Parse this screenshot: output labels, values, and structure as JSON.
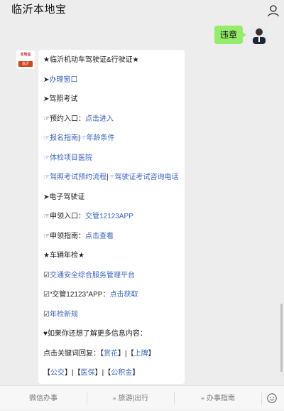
{
  "header": {
    "title": "临沂本地宝"
  },
  "outgoing_message": {
    "text": "违章"
  },
  "bot_avatar": {
    "line1": "本地宝",
    "line2": "临沂"
  },
  "message_lines": [
    {
      "parts": [
        {
          "t": "★临沂机动车驾驶证&行驶证★",
          "link": false
        }
      ]
    },
    {
      "parts": [
        {
          "t": "➤",
          "link": false
        },
        {
          "t": "办理窗口",
          "link": true
        }
      ]
    },
    {
      "parts": [
        {
          "t": "➤驾照考试",
          "link": false
        }
      ]
    },
    {
      "parts": [
        {
          "t": "☞预约入口：",
          "link": false
        },
        {
          "t": "点击进入",
          "link": true
        }
      ]
    },
    {
      "parts": [
        {
          "t": "☞报名指南",
          "link": true
        },
        {
          "t": "|",
          "link": false
        },
        {
          "t": "☞年龄条件",
          "link": true
        }
      ]
    },
    {
      "parts": [
        {
          "t": "☞体检项目医院",
          "link": true
        }
      ]
    },
    {
      "parts": [
        {
          "t": "☞驾照考试预约流程",
          "link": true
        },
        {
          "t": "|",
          "link": false
        },
        {
          "t": "☞驾驶证考试咨询电话",
          "link": true
        }
      ]
    },
    {
      "parts": [
        {
          "t": "➤电子驾驶证",
          "link": false
        }
      ]
    },
    {
      "parts": [
        {
          "t": "☞申领入口：",
          "link": false
        },
        {
          "t": "交管12123APP",
          "link": true
        }
      ]
    },
    {
      "parts": [
        {
          "t": "☞申领指南：",
          "link": false
        },
        {
          "t": "点击查看",
          "link": true
        }
      ]
    },
    {
      "parts": [
        {
          "t": "★车辆年检★",
          "link": false
        }
      ]
    },
    {
      "parts": [
        {
          "t": "☑",
          "link": false
        },
        {
          "t": "交通安全综合服务管理平台",
          "link": true
        }
      ]
    },
    {
      "parts": [
        {
          "t": "☑“交管12123”APP：",
          "link": false
        },
        {
          "t": "点击获取",
          "link": true
        }
      ]
    },
    {
      "parts": [
        {
          "t": "☑",
          "link": false
        },
        {
          "t": "年检新规",
          "link": true
        }
      ]
    },
    {
      "parts": [
        {
          "t": "♥如果你还想了解更多信息内容：",
          "link": false
        }
      ]
    },
    {
      "parts": [
        {
          "t": "点击关键词回复：【",
          "link": false
        },
        {
          "t": "赏花",
          "link": true
        },
        {
          "t": "】|【",
          "link": false
        },
        {
          "t": "上牌",
          "link": true
        },
        {
          "t": "】",
          "link": false
        }
      ]
    },
    {
      "parts": [
        {
          "t": "【",
          "link": false
        },
        {
          "t": "公交",
          "link": true
        },
        {
          "t": "】|【",
          "link": false
        },
        {
          "t": "医保",
          "link": true
        },
        {
          "t": "】|【",
          "link": false
        },
        {
          "t": "公积金",
          "link": true
        },
        {
          "t": "】",
          "link": false
        }
      ]
    }
  ],
  "bottom_menu": [
    {
      "label": "微信办事",
      "hamburger": false
    },
    {
      "label": "旅游|出行",
      "hamburger": true
    },
    {
      "label": "办事指南",
      "hamburger": true
    }
  ],
  "colors": {
    "link": "#3a64c6",
    "outgoing_bubble": "#95ec69",
    "background": "#ededed"
  },
  "icons": {
    "profile": "person-icon",
    "keyboard": "keyboard-icon",
    "menu": "hamburger-icon"
  }
}
